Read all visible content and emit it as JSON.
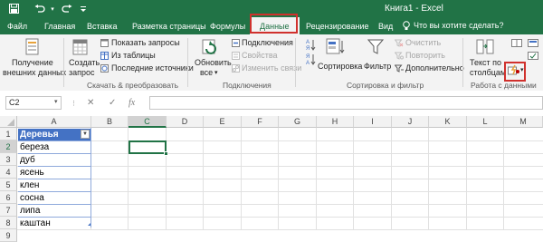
{
  "app": {
    "title": "Книга1 - Excel",
    "accent_color": "#217346",
    "highlight_color": "#d0312d"
  },
  "qat": [
    {
      "name": "save-icon",
      "symbol": "🖫"
    },
    {
      "name": "undo-icon",
      "symbol": "↶"
    },
    {
      "name": "redo-icon",
      "symbol": "↷"
    },
    {
      "name": "customize-qat-icon",
      "symbol": "⌄"
    }
  ],
  "tabs": [
    {
      "label": "Файл"
    },
    {
      "label": "Главная"
    },
    {
      "label": "Вставка"
    },
    {
      "label": "Разметка страницы"
    },
    {
      "label": "Формулы"
    },
    {
      "label": "Данные",
      "active": true
    },
    {
      "label": "Рецензирование"
    },
    {
      "label": "Вид"
    }
  ],
  "search": {
    "placeholder": "Что вы хотите сделать?",
    "icon": "lightbulb-icon"
  },
  "ribbon": {
    "external": {
      "label_line1": "Получение",
      "label_line2": "внешних данных"
    },
    "create_query": {
      "label_line1": "Создать",
      "label_line2": "запрос"
    },
    "show_queries": "Показать запросы",
    "from_table": "Из таблицы",
    "recent_sources": "Последние источники",
    "refresh": {
      "label_line1": "Обновить",
      "label_line2": "все"
    },
    "connections": "Подключения",
    "properties": "Свойства",
    "edit_links": "Изменить связи",
    "sort_az": "А\nЯ",
    "sort_za": "Я\nА",
    "sort": "Сортировка",
    "filter": "Фильтр",
    "clear": "Очистить",
    "reapply": "Повторить",
    "advanced": "Дополнительно",
    "text_to_columns": {
      "label_line1": "Текст по",
      "label_line2": "столбцам"
    },
    "groups": {
      "get_transform": "Скачать & преобразовать",
      "connections": "Подключения",
      "sort_filter": "Сортировка и фильтр",
      "data_tools": "Работа с данными"
    }
  },
  "formula_bar": {
    "name_box": "C2",
    "cancel": "✕",
    "enter": "✓",
    "fx": "fx",
    "value": ""
  },
  "grid": {
    "columns": [
      "A",
      "B",
      "C",
      "D",
      "E",
      "F",
      "G",
      "H",
      "I",
      "J",
      "K",
      "L",
      "M"
    ],
    "selected_column": "C",
    "rows": [
      "1",
      "2",
      "3",
      "4",
      "5",
      "6",
      "7",
      "8",
      "9"
    ],
    "selected_row": "2",
    "table": {
      "header": "Деревья",
      "values": [
        "береза",
        "дуб",
        "ясень",
        "клен",
        "сосна",
        "липа",
        "каштан"
      ]
    },
    "active_cell": "C2"
  }
}
